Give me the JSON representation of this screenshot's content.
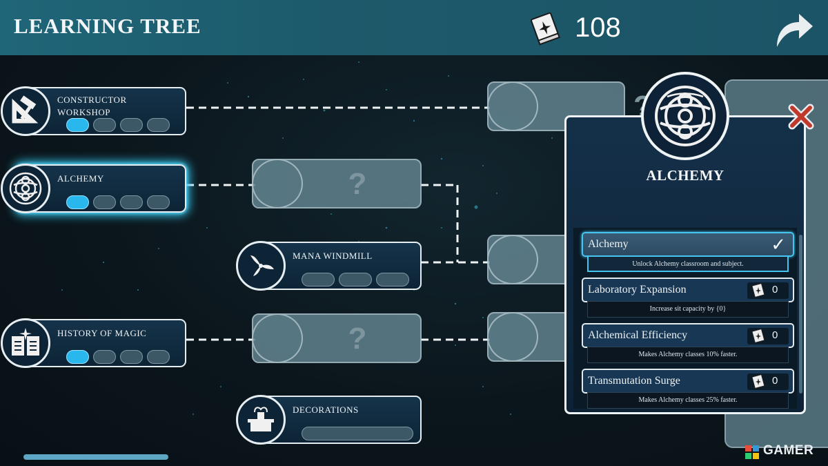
{
  "header": {
    "title": "LEARNING TREE",
    "currency_value": "108",
    "currency_icon": "spellbook-icon",
    "back_icon": "curved-arrow-icon"
  },
  "tree": {
    "constructor": {
      "label_line1": "CONSTRUCTOR",
      "label_line2": "WORKSHOP",
      "icon": "hammer-ruler-icon",
      "levels_unlocked": 1,
      "levels_total": 4
    },
    "alchemy": {
      "label": "ALCHEMY",
      "icon": "alchemy-circle-icon",
      "levels_unlocked": 1,
      "levels_total": 4
    },
    "mana_windmill": {
      "label": "MANA WINDMILL",
      "icon": "windmill-icon",
      "levels_unlocked": 0,
      "levels_total": 3
    },
    "history_of_magic": {
      "label": "HISTORY OF MAGIC",
      "icon": "open-book-icon",
      "levels_unlocked": 1,
      "levels_total": 4
    },
    "decorations": {
      "label": "DECORATIONS",
      "icon": "fountain-icon",
      "levels_unlocked": 0,
      "levels_total": 1
    },
    "locked_symbol": "?"
  },
  "panel": {
    "title": "ALCHEMY",
    "close_icon": "close-x-icon",
    "upgrades": [
      {
        "name": "Alchemy",
        "desc": "Unlock Alchemy classroom and subject.",
        "status": "unlocked",
        "check": "✓"
      },
      {
        "name": "Laboratory Expansion",
        "desc": "Increase sit capacity by {0}",
        "cost": "0"
      },
      {
        "name": "Alchemical Efficiency",
        "desc": "Makes Alchemy classes 10% faster.",
        "cost": "0"
      },
      {
        "name": "Transmutation Surge",
        "desc": "Makes Alchemy classes 25% faster.",
        "cost": "0"
      }
    ]
  },
  "watermark": {
    "text": "GAMER"
  },
  "colors": {
    "accent": "#28b8ee",
    "topbar": "#1f6678",
    "panel": "#143049"
  }
}
